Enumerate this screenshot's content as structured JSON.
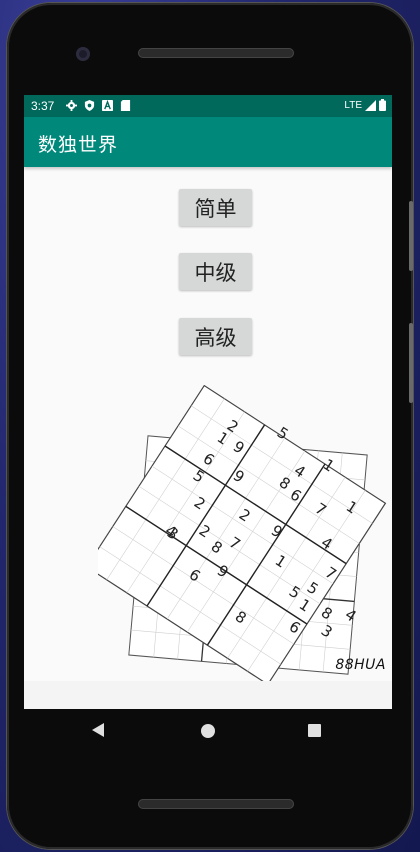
{
  "status_bar": {
    "time": "3:37",
    "network": "LTE",
    "icons": [
      "settings-icon",
      "shield-icon",
      "a-badge-icon",
      "sd-card-icon"
    ]
  },
  "app_bar": {
    "title": "数独世界"
  },
  "difficulty_buttons": {
    "easy": "简单",
    "medium": "中级",
    "hard": "高级"
  },
  "illustration": {
    "watermark": "88HUA",
    "grid_digits": [
      "2",
      "5",
      "1",
      "9",
      "6",
      "4",
      "1",
      "5",
      "9",
      "8",
      "6",
      "7",
      "1",
      "2",
      "2",
      "9",
      "4",
      "3",
      "2",
      "8",
      "7",
      "1",
      "7",
      "6",
      "9",
      "5",
      "5",
      "1",
      "8",
      "4",
      "8",
      "6",
      "3",
      "4"
    ]
  },
  "colors": {
    "status_bar": "#00695c",
    "app_bar": "#00897b",
    "button_bg": "#d6d7d7",
    "screen_bg": "#fafafa"
  }
}
